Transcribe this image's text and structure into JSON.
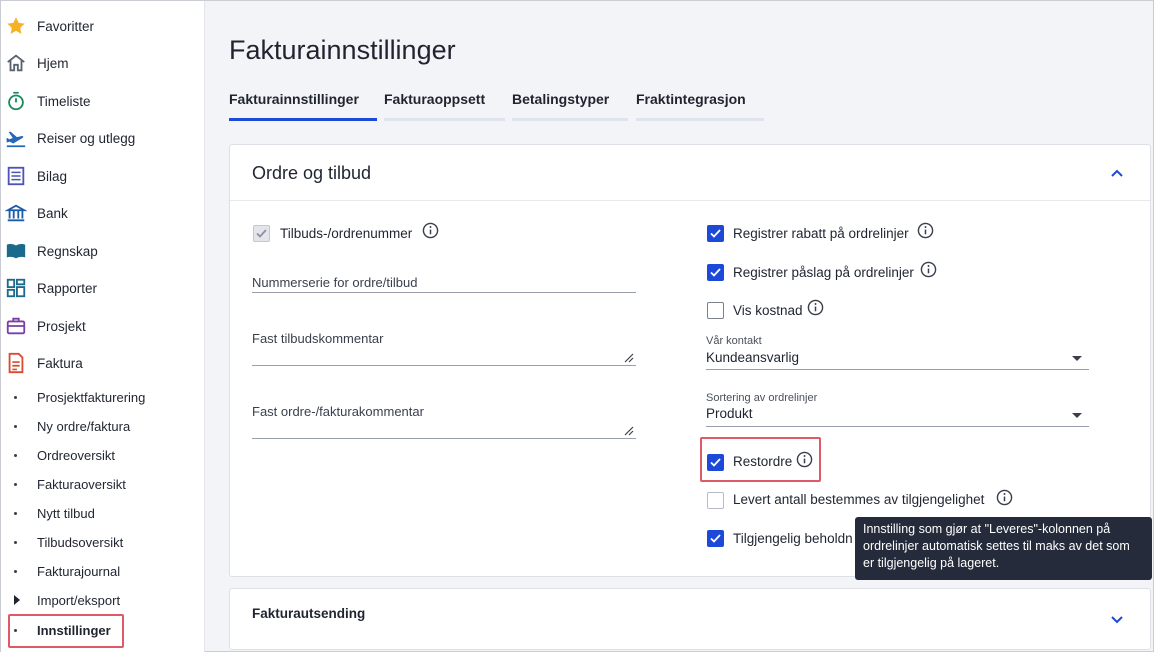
{
  "sidebar": {
    "items": [
      {
        "label": "Favoritter",
        "icon": "star-icon"
      },
      {
        "label": "Hjem",
        "icon": "home-icon"
      },
      {
        "label": "Timeliste",
        "icon": "stopwatch-icon"
      },
      {
        "label": "Reiser og utlegg",
        "icon": "airplane-icon"
      },
      {
        "label": "Bilag",
        "icon": "document-list-icon"
      },
      {
        "label": "Bank",
        "icon": "bank-icon"
      },
      {
        "label": "Regnskap",
        "icon": "book-icon"
      },
      {
        "label": "Rapporter",
        "icon": "dashboard-icon"
      },
      {
        "label": "Prosjekt",
        "icon": "briefcase-icon"
      },
      {
        "label": "Faktura",
        "icon": "invoice-icon"
      }
    ],
    "subitems": [
      {
        "label": "Prosjektfakturering"
      },
      {
        "label": "Ny ordre/faktura"
      },
      {
        "label": "Ordreoversikt"
      },
      {
        "label": "Fakturaoversikt"
      },
      {
        "label": "Nytt tilbud"
      },
      {
        "label": "Tilbudsoversikt"
      },
      {
        "label": "Fakturajournal"
      },
      {
        "label": "Import/eksport"
      },
      {
        "label": "Innstillinger"
      }
    ]
  },
  "page": {
    "title": "Fakturainnstillinger"
  },
  "tabs": [
    {
      "label": "Fakturainnstillinger"
    },
    {
      "label": "Fakturaoppsett"
    },
    {
      "label": "Betalingstyper"
    },
    {
      "label": "Fraktintegrasjon"
    }
  ],
  "section1": {
    "title": "Ordre og tilbud",
    "left": {
      "number_checkbox_label": "Tilbuds-/ordrenummer",
      "number_series_placeholder": "Nummerserie for ordre/tilbud",
      "offer_comment_placeholder": "Fast tilbudskommentar",
      "order_comment_placeholder": "Fast ordre-/fakturakommentar"
    },
    "right": {
      "discount_label": "Registrer rabatt på ordrelinjer",
      "markup_label": "Registrer påslag på ordrelinjer",
      "show_cost_label": "Vis kostnad",
      "contact_label": "Vår kontakt",
      "contact_value": "Kundeansvarlig",
      "sort_label": "Sortering av ordrelinjer",
      "sort_value": "Produkt",
      "backorder_label": "Restordre",
      "delivered_label": "Levert antall bestemmes av tilgjengelighet",
      "available_label": "Tilgjengelig beholdn"
    }
  },
  "tooltip": {
    "text": "Innstilling som gjør at \"Leveres\"-kolonnen på ordrelinjer automatisk settes til maks av det som er tilgjengelig på lageret."
  },
  "section2": {
    "title": "Fakturautsending"
  },
  "colors": {
    "accent": "#1d49d8",
    "highlight": "#de5a68",
    "tooltip_bg": "#252b3a"
  }
}
